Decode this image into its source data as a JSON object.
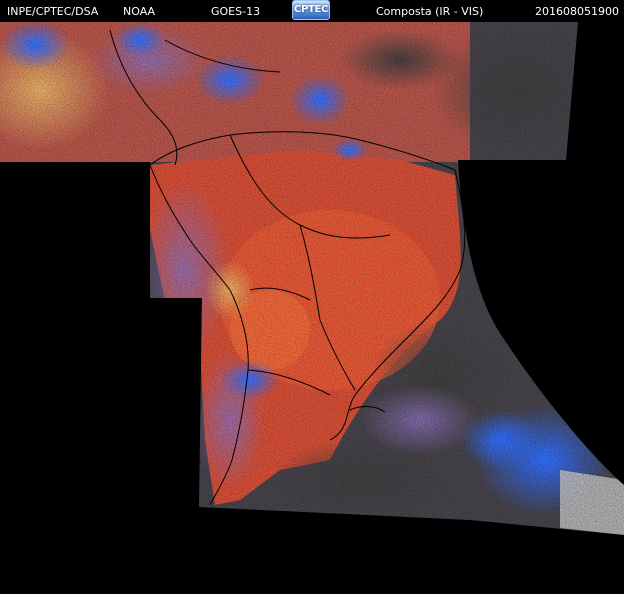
{
  "header": {
    "source": "INPE/CPTEC/DSA",
    "agency": "NOAA",
    "satellite": "GOES-13",
    "logo_text": "CPTEC",
    "product": "Composta (IR - VIS)",
    "timestamp": "201608051900"
  },
  "colors": {
    "background": "#000000",
    "cold_cloud": "#2e7cff",
    "warm_land": "#e0583a",
    "low_cloud": "#4a4a4a",
    "outline": "#000000"
  }
}
